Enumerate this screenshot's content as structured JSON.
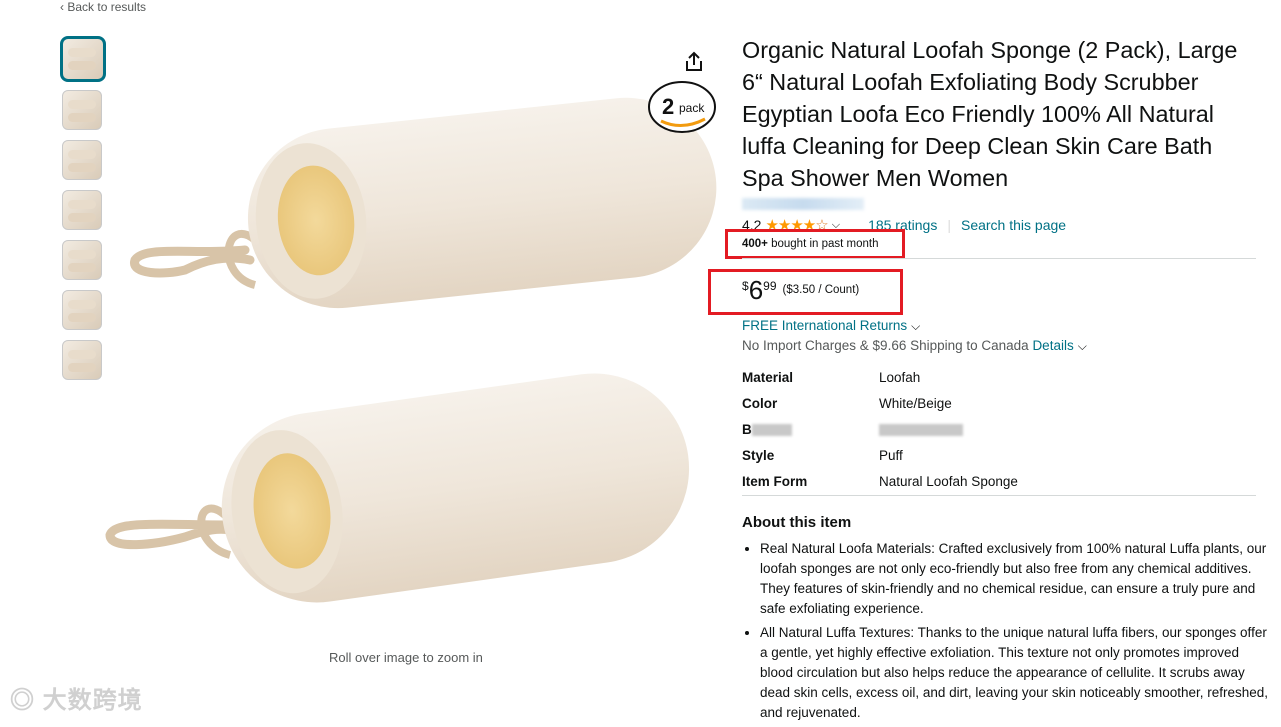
{
  "back_link": "Back to results",
  "thumbnails": [
    "thumbnail-1",
    "thumbnail-2",
    "thumbnail-3",
    "thumbnail-4",
    "thumbnail-5",
    "thumbnail-6",
    "thumbnail-7"
  ],
  "image": {
    "badge_number": "2",
    "badge_word": "pack",
    "zoom_hint": "Roll over image to zoom in"
  },
  "product": {
    "title": "Organic Natural Loofah Sponge (2 Pack), Large 6“ Natural Loofah Exfoliating Body Scrubber Egyptian Loofa Eco Friendly 100% All Natural luffa Cleaning for Deep Clean Skin Care Bath Spa Shower Men Women",
    "rating_value": "4.2",
    "stars_filled": "★★★★",
    "stars_empty": "☆",
    "ratings_count": "185 ratings",
    "search_page": "Search this page",
    "bought_bold": "400+",
    "bought_rest": " bought in past month",
    "price": {
      "currency": "$",
      "whole": "6",
      "fraction": "99",
      "unit_price": "($3.50 / Count)"
    },
    "returns": "FREE International Returns",
    "import_text": "No Import Charges & $9.66 Shipping to Canada ",
    "details_link": "Details",
    "specs": [
      {
        "key": "Material",
        "value": "Loofah"
      },
      {
        "key": "Color",
        "value": "White/Beige"
      },
      {
        "key": "B",
        "value": ""
      },
      {
        "key": "Style",
        "value": "Puff"
      },
      {
        "key": "Item Form",
        "value": "Natural Loofah Sponge"
      }
    ],
    "about_heading": "About this item",
    "bullets": [
      "Real Natural Loofa Materials: Crafted exclusively from 100% natural Luffa plants, our loofah sponges are not only eco-friendly but also free from any chemical additives. They features of skin-friendly and no chemical residue, can ensure a truly pure and safe exfoliating experience.",
      "All Natural Luffa Textures: Thanks to the unique natural luffa fibers, our sponges offer a gentle, yet highly effective exfoliation. This texture not only promotes improved blood circulation but also helps reduce the appearance of cellulite. It scrubs away dead skin cells, excess oil, and dirt, leaving your skin noticeably smoother, refreshed, and rejuvenated."
    ]
  },
  "watermark": "大数跨境",
  "colors": {
    "link": "#007185",
    "star": "#ff9900",
    "highlight_box": "#e31b23",
    "selected_thumb": "#007185"
  }
}
